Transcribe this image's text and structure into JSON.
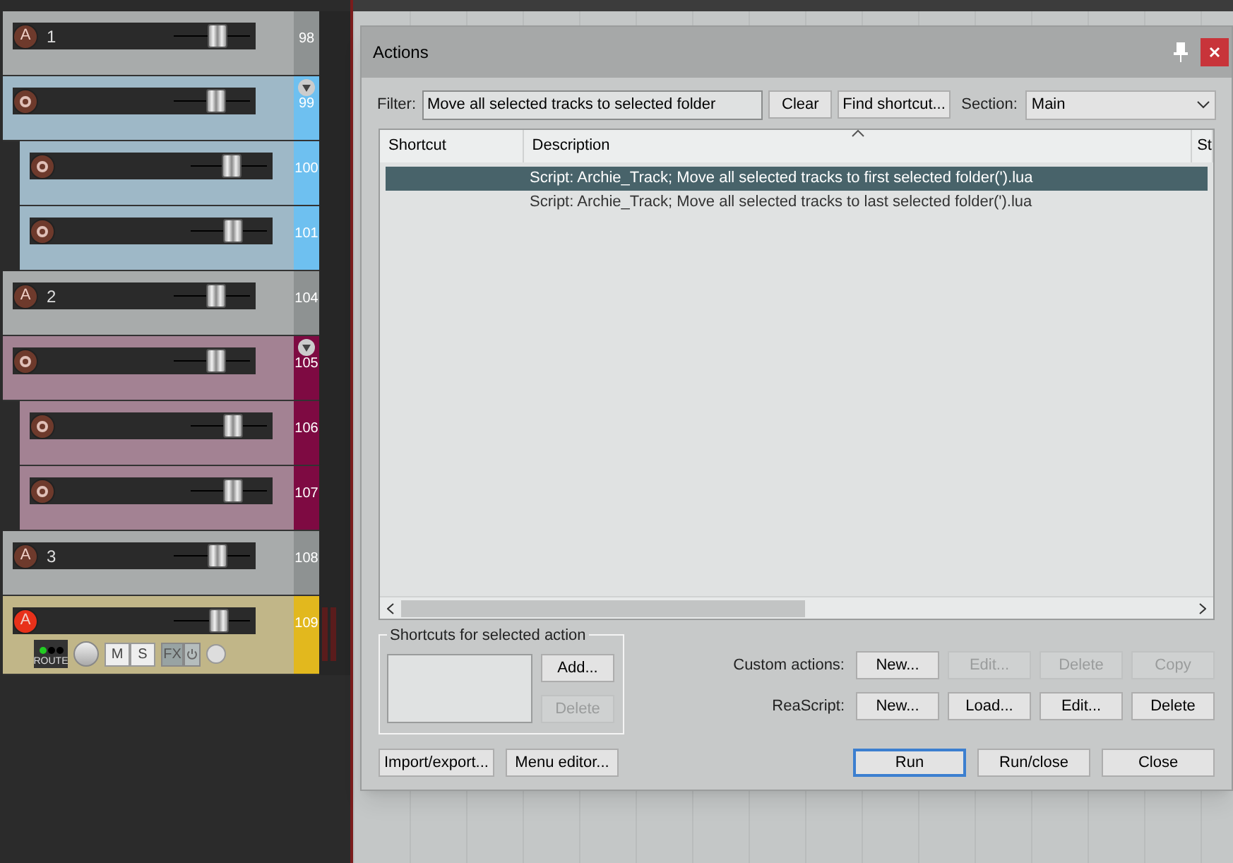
{
  "tracks": [
    {
      "arm_label": "A",
      "name": "1",
      "number": "98",
      "color": "#8e9292",
      "armed": false,
      "level": 0.57
    },
    {
      "number": "99",
      "color": "#6ec0f0",
      "armed": false,
      "level": 0.55,
      "expanded": true,
      "children": [
        {
          "number": "100",
          "color": "#6ec0f0",
          "armed": false,
          "level": 0.53
        },
        {
          "number": "101",
          "color": "#6ec0f0",
          "armed": false,
          "level": 0.55
        }
      ]
    },
    {
      "arm_label": "A",
      "name": "2",
      "number": "104",
      "color": "#8e9292",
      "armed": false,
      "level": 0.55
    },
    {
      "number": "105",
      "color": "#7e0a42",
      "armed": false,
      "level": 0.55,
      "expanded": true,
      "children": [
        {
          "number": "106",
          "color": "#7e0a42",
          "armed": false,
          "level": 0.55
        },
        {
          "number": "107",
          "color": "#7e0a42",
          "armed": false,
          "level": 0.55
        }
      ]
    },
    {
      "arm_label": "A",
      "name": "3",
      "number": "108",
      "color": "#8e9292",
      "armed": false,
      "level": 0.57
    },
    {
      "arm_label": "A",
      "number": "109",
      "color": "#e2b81e",
      "armed": true,
      "level": 0.6,
      "controls": {
        "route": "ROUTE",
        "mute": "M",
        "solo": "S",
        "fx": "FX"
      }
    }
  ],
  "dialog": {
    "title": "Actions",
    "filter": {
      "label": "Filter:",
      "value": "Move all selected tracks to selected folder"
    },
    "filter_buttons": [
      {
        "label": "Clear"
      },
      {
        "label": "Find shortcut..."
      }
    ],
    "section": {
      "label": "Section:",
      "value": "Main"
    },
    "table": {
      "columns": [
        "Shortcut",
        "Description",
        "St"
      ],
      "rows": [
        {
          "shortcut": "",
          "description": "Script: Archie_Track;  Move all selected tracks to first selected folder(').lua",
          "selected": true
        },
        {
          "description": "Script: Archie_Track;  Move all selected tracks to last selected folder(').lua",
          "selected": false
        }
      ]
    },
    "shortcuts_group": {
      "title": "Shortcuts for selected action",
      "buttons": [
        {
          "label": "Add...",
          "disabled": false
        },
        {
          "label": "Delete",
          "disabled": true
        }
      ]
    },
    "custom_actions": {
      "label": "Custom actions:",
      "buttons": [
        {
          "label": "New...",
          "disabled": false
        },
        {
          "label": "Edit...",
          "disabled": true
        },
        {
          "label": "Delete",
          "disabled": true
        },
        {
          "label": "Copy",
          "disabled": true
        }
      ]
    },
    "reascript": {
      "label": "ReaScript:",
      "buttons": [
        {
          "label": "New...",
          "disabled": false
        },
        {
          "label": "Load...",
          "disabled": false
        },
        {
          "label": "Edit...",
          "disabled": false
        },
        {
          "label": "Delete",
          "disabled": false
        }
      ]
    },
    "left_buttons": [
      {
        "label": "Import/export..."
      },
      {
        "label": "Menu editor..."
      }
    ],
    "right_buttons": [
      {
        "label": "Run",
        "default": true
      },
      {
        "label": "Run/close",
        "default": false
      },
      {
        "label": "Close",
        "default": false
      }
    ]
  }
}
